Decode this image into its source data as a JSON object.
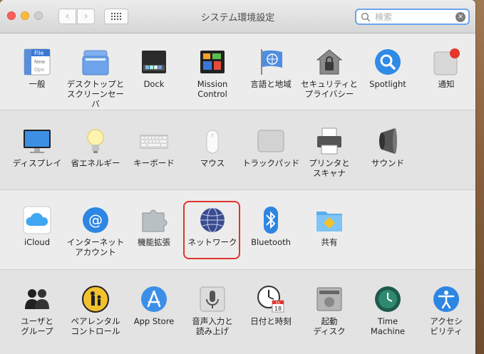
{
  "window": {
    "title": "システム環境設定"
  },
  "toolbar": {
    "back": "‹",
    "forward": "›"
  },
  "search": {
    "placeholder": "検索",
    "clear": "×"
  },
  "rows": [
    [
      {
        "id": "general",
        "label": "一般",
        "icon": "general-icon"
      },
      {
        "id": "desktop",
        "label": "デスクトップと\nスクリーンセーバ",
        "icon": "desktop-screensaver-icon"
      },
      {
        "id": "dock",
        "label": "Dock",
        "icon": "dock-icon"
      },
      {
        "id": "mission",
        "label": "Mission\nControl",
        "icon": "mission-control-icon"
      },
      {
        "id": "language",
        "label": "言語と地域",
        "icon": "language-region-icon"
      },
      {
        "id": "security",
        "label": "セキュリティと\nプライバシー",
        "icon": "security-privacy-icon"
      },
      {
        "id": "spotlight",
        "label": "Spotlight",
        "icon": "spotlight-icon"
      },
      {
        "id": "notifications",
        "label": "通知",
        "icon": "notifications-icon"
      }
    ],
    [
      {
        "id": "displays",
        "label": "ディスプレイ",
        "icon": "display-icon"
      },
      {
        "id": "energy",
        "label": "省エネルギー",
        "icon": "energy-saver-icon"
      },
      {
        "id": "keyboard",
        "label": "キーボード",
        "icon": "keyboard-icon"
      },
      {
        "id": "mouse",
        "label": "マウス",
        "icon": "mouse-icon"
      },
      {
        "id": "trackpad",
        "label": "トラックパッド",
        "icon": "trackpad-icon"
      },
      {
        "id": "printers",
        "label": "プリンタと\nスキャナ",
        "icon": "printer-icon"
      },
      {
        "id": "sound",
        "label": "サウンド",
        "icon": "sound-icon"
      }
    ],
    [
      {
        "id": "icloud",
        "label": "iCloud",
        "icon": "icloud-icon"
      },
      {
        "id": "internet",
        "label": "インターネット\nアカウント",
        "icon": "internet-accounts-icon"
      },
      {
        "id": "extensions",
        "label": "機能拡張",
        "icon": "extensions-icon"
      },
      {
        "id": "network",
        "label": "ネットワーク",
        "icon": "network-icon"
      },
      {
        "id": "bluetooth",
        "label": "Bluetooth",
        "icon": "bluetooth-icon"
      },
      {
        "id": "sharing",
        "label": "共有",
        "icon": "sharing-icon"
      }
    ],
    [
      {
        "id": "users",
        "label": "ユーザと\nグループ",
        "icon": "users-groups-icon"
      },
      {
        "id": "parental",
        "label": "ペアレンタル\nコントロール",
        "icon": "parental-controls-icon"
      },
      {
        "id": "appstore",
        "label": "App Store",
        "icon": "app-store-icon"
      },
      {
        "id": "dictation",
        "label": "音声入力と\n読み上げ",
        "icon": "dictation-speech-icon"
      },
      {
        "id": "datetime",
        "label": "日付と時刻",
        "icon": "date-time-icon"
      },
      {
        "id": "startup",
        "label": "起動\nディスク",
        "icon": "startup-disk-icon"
      },
      {
        "id": "timemachine",
        "label": "Time\nMachine",
        "icon": "time-machine-icon"
      },
      {
        "id": "accessibility",
        "label": "アクセシ\nビリティ",
        "icon": "accessibility-icon"
      }
    ]
  ],
  "icon_text": {
    "general_file": "File",
    "general_new": "New",
    "general_open": "Ope",
    "calendar_month": "JUL",
    "calendar_day": "18"
  },
  "colors": {
    "highlight": "#e0332e",
    "search_focus": "#6aa6ea"
  }
}
